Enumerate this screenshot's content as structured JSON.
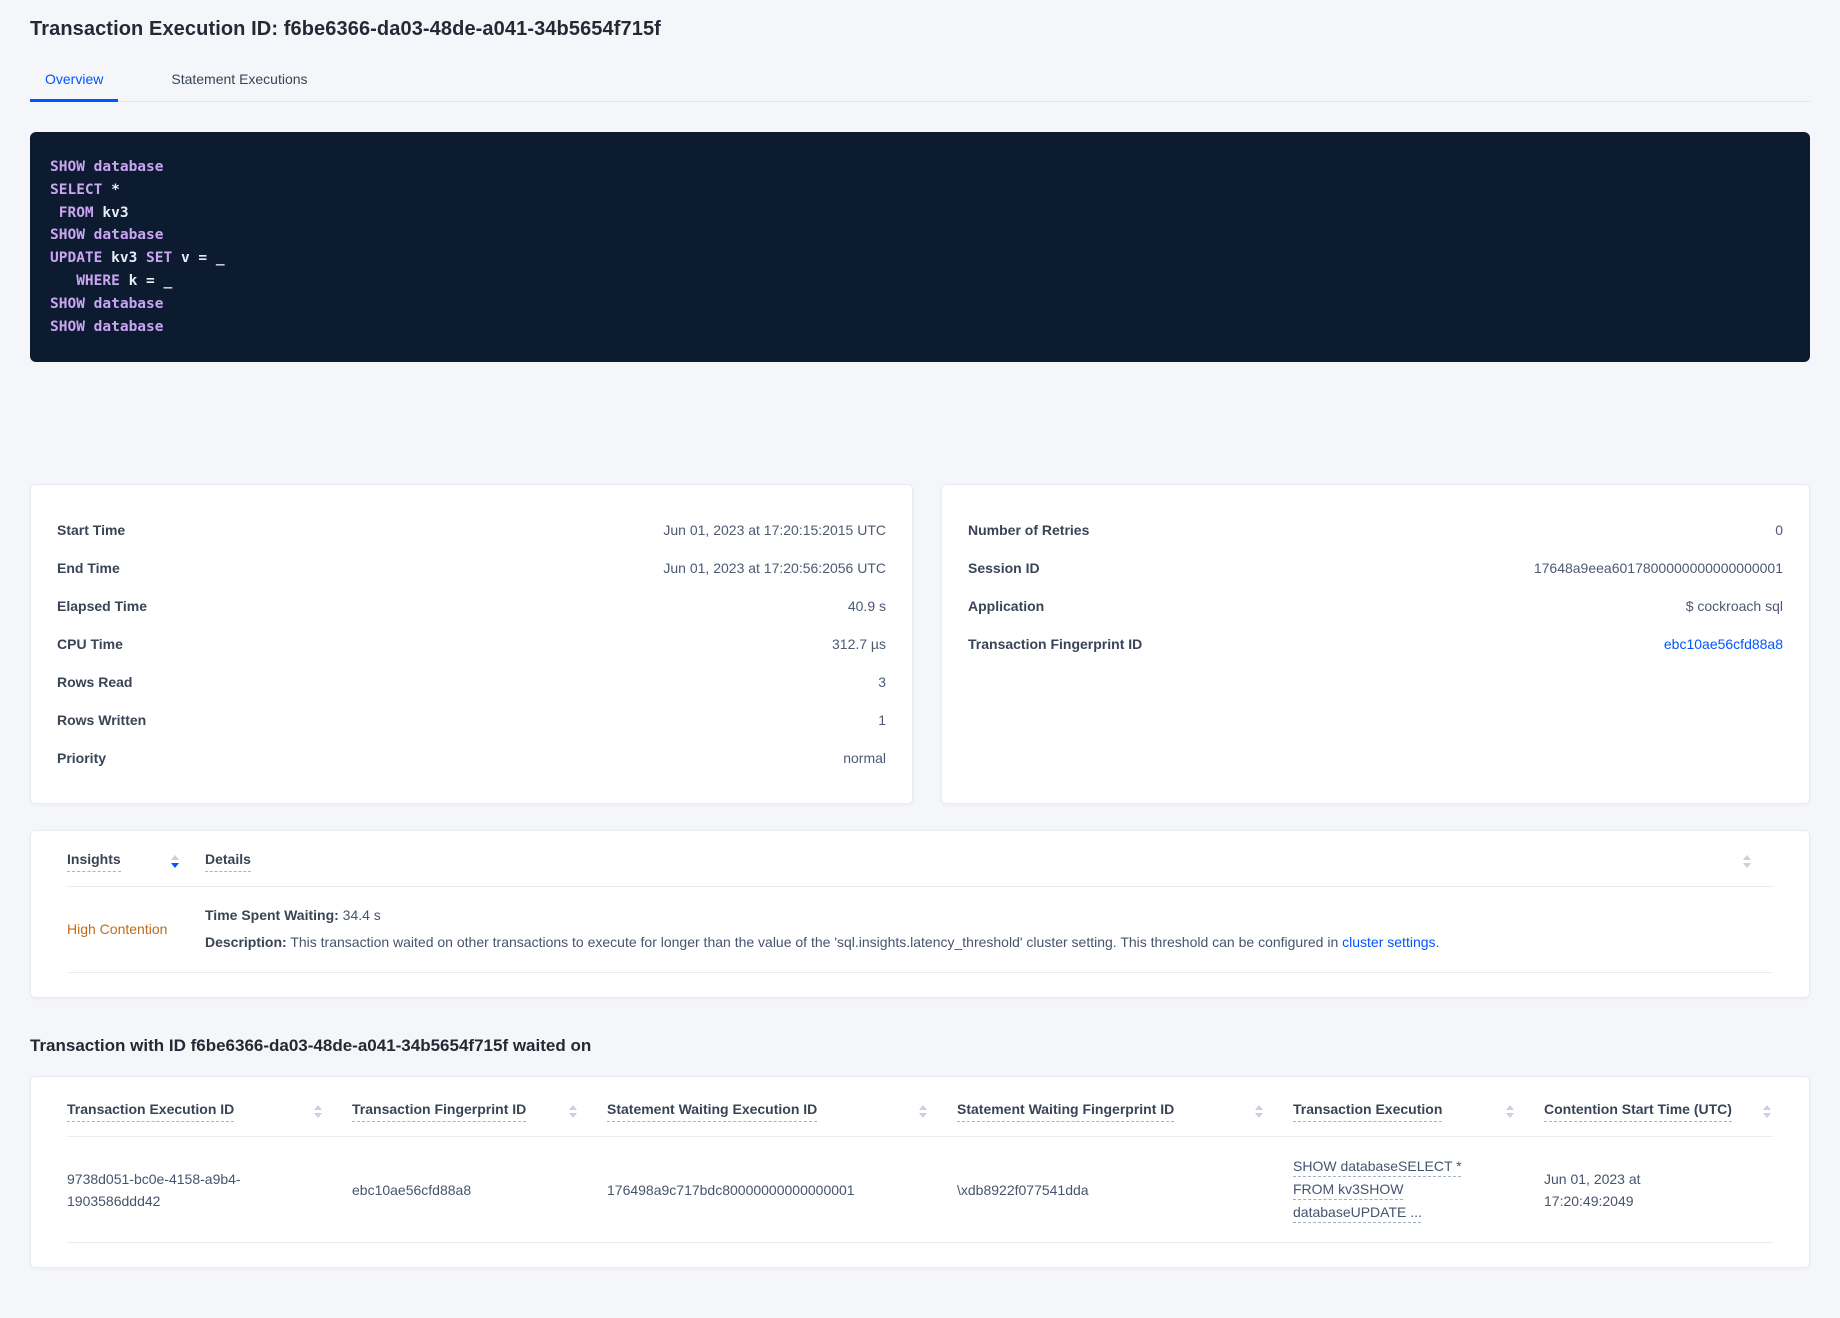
{
  "page": {
    "title": "Transaction Execution ID: f6be6366-da03-48de-a041-34b5654f715f"
  },
  "tabs": [
    {
      "label": "Overview",
      "active": true
    },
    {
      "label": "Statement Executions",
      "active": false
    }
  ],
  "colors": {
    "accent_blue": "#0055ff",
    "insight_orange": "#c26a17",
    "code_background": "#0d1b31",
    "code_keyword": "#c9a5f2",
    "code_plain": "#e8ecf5"
  },
  "sql": {
    "l1": "SHOW database",
    "l2_kw": "SELECT",
    "l2_rest": " *",
    "l3_kw": " FROM",
    "l3_rest": " kv3",
    "l4": "SHOW database",
    "l5_kw1": "UPDATE",
    "l5_id1": " kv3",
    "l5_kw2": " SET",
    "l5_rest": " v = _",
    "l6_kw": "   WHERE",
    "l6_rest": " k = _",
    "l7": "SHOW database",
    "l8": "SHOW database"
  },
  "summary_left": {
    "rows": [
      {
        "label": "Start Time",
        "value": "Jun 01, 2023 at 17:20:15:2015 UTC"
      },
      {
        "label": "End Time",
        "value": "Jun 01, 2023 at 17:20:56:2056 UTC"
      },
      {
        "label": "Elapsed Time",
        "value": "40.9 s"
      },
      {
        "label": "CPU Time",
        "value": "312.7 µs"
      },
      {
        "label": "Rows Read",
        "value": "3"
      },
      {
        "label": "Rows Written",
        "value": "1"
      },
      {
        "label": "Priority",
        "value": "normal"
      }
    ]
  },
  "summary_right": {
    "rows": [
      {
        "label": "Number of Retries",
        "value": "0"
      },
      {
        "label": "Session ID",
        "value": "17648a9eea6017800000000000000001"
      },
      {
        "label": "Application",
        "value": "$ cockroach sql"
      }
    ],
    "fingerprint_label": "Transaction Fingerprint ID",
    "fingerprint_value": "ebc10ae56cfd88a8"
  },
  "insights_table": {
    "columns": [
      "Insights",
      "Details"
    ],
    "row": {
      "insight": "High Contention",
      "waiting_label": "Time Spent Waiting:",
      "waiting_value": " 34.4 s",
      "description_label": "Description:",
      "description_text": " This transaction waited on other transactions to execute for longer than the value of the 'sql.insights.latency_threshold' cluster setting. This threshold can be configured in ",
      "description_link": "cluster settings",
      "description_suffix": "."
    }
  },
  "waited_on": {
    "heading": "Transaction with ID f6be6366-da03-48de-a041-34b5654f715f waited on",
    "columns": [
      "Transaction Execution ID",
      "Transaction Fingerprint ID",
      "Statement Waiting Execution ID",
      "Statement Waiting Fingerprint ID",
      "Transaction Execution",
      "Contention Start Time (UTC)"
    ],
    "row": {
      "transaction_execution_id": "9738d051-bc0e-4158-a9b4-1903586ddd42",
      "transaction_fingerprint_id": "ebc10ae56cfd88a8",
      "statement_waiting_execution_id": "176498a9c717bdc80000000000000001",
      "statement_waiting_fingerprint_id": "\\xdb8922f077541dda",
      "transaction_execution": "SHOW databaseSELECT * FROM kv3SHOW databaseUPDATE ...",
      "contention_start_time": "Jun 01, 2023 at 17:20:49:2049"
    }
  }
}
